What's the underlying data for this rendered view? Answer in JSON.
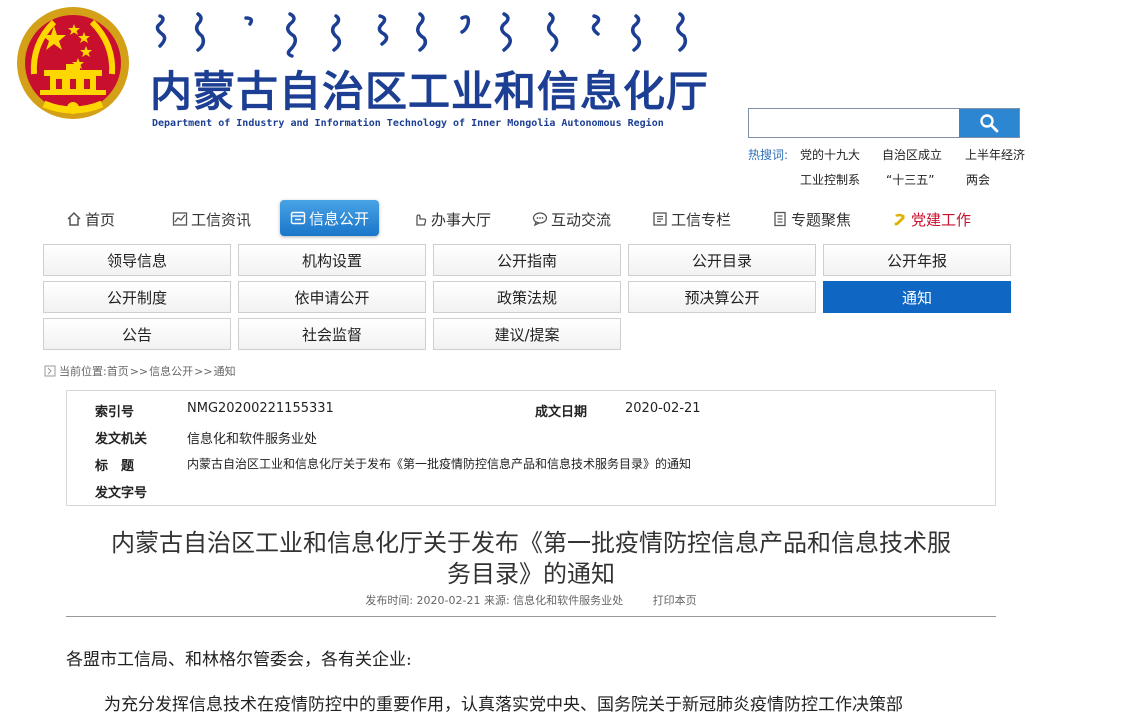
{
  "header": {
    "site_title": "内蒙古自治区工业和信息化厅",
    "site_subtitle": "Department of Industry and Information Technology of Inner Mongolia Autonomous Region"
  },
  "search": {
    "value": "",
    "placeholder": "",
    "hot_label": "热搜词:",
    "hot_words": [
      "党的十九大",
      "自治区成立",
      "上半年经济",
      "工业控制系",
      "“十三五”",
      "两会"
    ]
  },
  "main_nav": {
    "items": [
      {
        "label": "首页",
        "icon": "home-icon"
      },
      {
        "label": "工信资讯",
        "icon": "chart-icon"
      },
      {
        "label": "信息公开",
        "icon": "window-icon",
        "active": true
      },
      {
        "label": "办事大厅",
        "icon": "hand-icon"
      },
      {
        "label": "互动交流",
        "icon": "chat-icon"
      },
      {
        "label": "工信专栏",
        "icon": "book-icon"
      },
      {
        "label": "专题聚焦",
        "icon": "doc-icon"
      },
      {
        "label": "党建工作",
        "icon": "party-emblem-icon"
      }
    ]
  },
  "sub_nav": {
    "items": [
      "领导信息",
      "机构设置",
      "公开指南",
      "公开目录",
      "公开年报",
      "公开制度",
      "依申请公开",
      "政策法规",
      "预决算公开",
      "通知",
      "公告",
      "社会监督",
      "建议/提案"
    ],
    "active": "通知"
  },
  "breadcrumb": {
    "prefix": "当前位置:",
    "items": [
      "首页",
      "信息公开",
      "通知"
    ],
    "separator": ">>"
  },
  "info": {
    "index_label": "索引号",
    "index_value": "NMG20200221155331",
    "date_label": "成文日期",
    "date_value": "2020-02-21",
    "issuer_label": "发文机关",
    "issuer_value": "信息化和软件服务业处",
    "title_label": "标　题",
    "title_value": "内蒙古自治区工业和信息化厅关于发布《第一批疫情防控信息产品和信息技术服务目录》的通知",
    "docno_label": "发文字号",
    "docno_value": ""
  },
  "article": {
    "title_line1": "内蒙古自治区工业和信息化厅关于发布《第一批疫情防控信息产品和信息技术服",
    "title_line2": "务目录》的通知",
    "meta": "发布时间: 2020-02-21 来源: 信息化和软件服务业处",
    "print_label": "打印本页",
    "salutation": "各盟市工信局、和林格尔管委会，各有关企业:",
    "para1": "为充分发挥信息技术在疫情防控中的重要作用，认真落实党中央、国务院关于新冠肺炎疫情防控工作决策部"
  },
  "colors": {
    "brand_blue": "#1c3f94",
    "nav_active": "#1976c9",
    "sub_active": "#0f66c3",
    "search_button": "#2c86d1",
    "party_red": "#c8102e"
  }
}
